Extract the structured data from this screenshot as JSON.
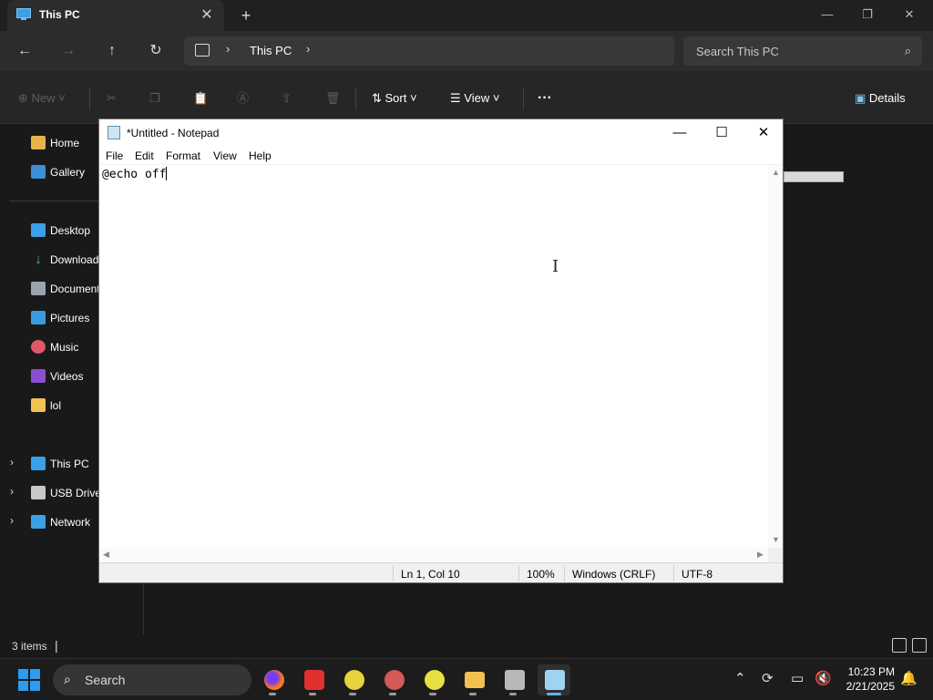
{
  "explorer": {
    "tab_title": "This PC",
    "address": {
      "crumb": "This PC"
    },
    "search_placeholder": "Search This PC",
    "toolbar": {
      "new_label": "New",
      "sort_label": "Sort",
      "view_label": "View",
      "more_label": "···",
      "details_label": "Details"
    },
    "sidebar": {
      "items": [
        {
          "label": "Home",
          "icon": "home-icon"
        },
        {
          "label": "Gallery",
          "icon": "gallery-icon"
        },
        {
          "label": "Desktop",
          "icon": "desktop-icon"
        },
        {
          "label": "Downloads",
          "icon": "download-icon"
        },
        {
          "label": "Documents",
          "icon": "document-icon"
        },
        {
          "label": "Pictures",
          "icon": "pictures-icon"
        },
        {
          "label": "Music",
          "icon": "music-icon"
        },
        {
          "label": "Videos",
          "icon": "videos-icon"
        },
        {
          "label": "lol",
          "icon": "folder-icon"
        },
        {
          "label": "This PC",
          "icon": "pc-icon"
        },
        {
          "label": "USB Drive",
          "icon": "usb-drive-icon"
        },
        {
          "label": "Network",
          "icon": "network-icon"
        }
      ]
    },
    "status": {
      "item_count": "3 items"
    }
  },
  "notepad": {
    "title": "*Untitled - Notepad",
    "menu": [
      "File",
      "Edit",
      "Format",
      "View",
      "Help"
    ],
    "content": "@echo off",
    "status": {
      "position": "Ln 1, Col 10",
      "zoom": "100%",
      "line_ending": "Windows (CRLF)",
      "encoding": "UTF-8"
    }
  },
  "taskbar": {
    "search_placeholder": "Search",
    "clock": {
      "time": "10:23 PM",
      "date": "2/21/2025"
    }
  },
  "colors": {
    "accent": "#2b9cf2",
    "window_bg": "#191919",
    "notepad_bg": "#ffffff"
  }
}
